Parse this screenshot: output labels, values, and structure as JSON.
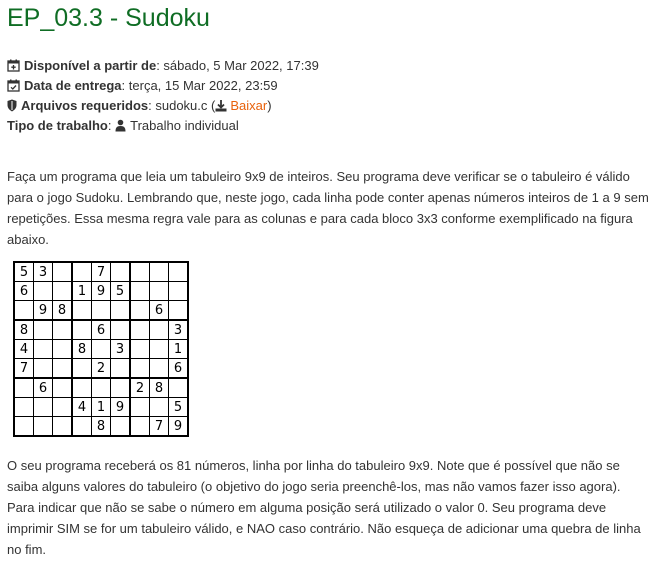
{
  "title": "EP_03.3 - Sudoku",
  "meta": {
    "available_label": "Disponível a partir de",
    "available_value": ": sábado, 5 Mar 2022, 17:39",
    "due_label": "Data de entrega",
    "due_value": ": terça, 15 Mar 2022, 23:59",
    "files_label": "Arquivos requeridos",
    "files_value": ": sudoku.c (",
    "download_label": "Baixar",
    "files_close": ")",
    "type_label": "Tipo de trabalho",
    "type_sep": ": ",
    "type_value": "Trabalho individual"
  },
  "intro": "Faça um programa que leia um tabuleiro 9x9 de inteiros. Seu programa deve verificar se o tabuleiro é válido para o jogo Sudoku. Lembrando que, neste jogo, cada linha pode conter apenas números inteiros de 1 a 9 sem repetições. Essa mesma regra vale para as colunas e para cada bloco 3x3 conforme exemplificado na figura abaixo.",
  "sudoku": [
    [
      "5",
      "3",
      "",
      "",
      "7",
      "",
      "",
      "",
      ""
    ],
    [
      "6",
      "",
      "",
      "1",
      "9",
      "5",
      "",
      "",
      ""
    ],
    [
      "",
      "9",
      "8",
      "",
      "",
      "",
      "",
      "6",
      ""
    ],
    [
      "8",
      "",
      "",
      "",
      "6",
      "",
      "",
      "",
      "3"
    ],
    [
      "4",
      "",
      "",
      "8",
      "",
      "3",
      "",
      "",
      "1"
    ],
    [
      "7",
      "",
      "",
      "",
      "2",
      "",
      "",
      "",
      "6"
    ],
    [
      "",
      "6",
      "",
      "",
      "",
      "",
      "2",
      "8",
      ""
    ],
    [
      "",
      "",
      "",
      "4",
      "1",
      "9",
      "",
      "",
      "5"
    ],
    [
      "",
      "",
      "",
      "",
      "8",
      "",
      "",
      "7",
      "9"
    ]
  ],
  "outro": "O seu programa receberá os 81 números, linha por linha do tabuleiro 9x9. Note que é possível que não se saiba alguns valores do tabuleiro (o objetivo do jogo seria preenchê-los, mas não vamos fazer isso agora). Para indicar que não se sabe o número em alguma posição será utilizado o valor 0. Seu programa deve imprimir SIM se for um tabuleiro válido, e NAO caso contrário. Não esqueça de adicionar uma quebra de linha no fim.",
  "icons": {
    "available": "calendar-plus-icon",
    "due": "calendar-check-icon",
    "files": "shield-icon",
    "download": "download-icon",
    "type": "user-icon"
  },
  "colors": {
    "title": "#0f6d24",
    "link": "#e8610b",
    "text": "#333333"
  }
}
